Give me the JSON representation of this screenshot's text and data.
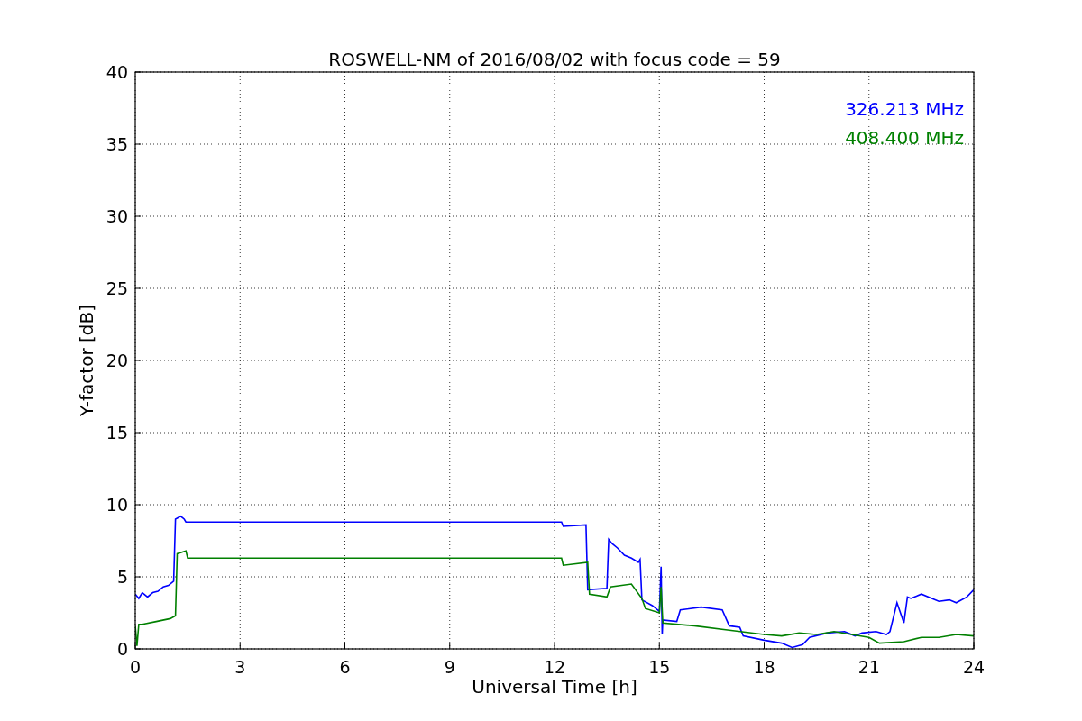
{
  "chart_data": {
    "type": "line",
    "title": "ROSWELL-NM of 2016/08/02 with focus code = 59",
    "xlabel": "Universal Time [h]",
    "ylabel": "Y-factor [dB]",
    "xlim": [
      0,
      24
    ],
    "ylim": [
      0,
      40
    ],
    "xticks": [
      0,
      3,
      6,
      9,
      12,
      15,
      18,
      21,
      24
    ],
    "yticks": [
      0,
      5,
      10,
      15,
      20,
      25,
      30,
      35,
      40
    ],
    "grid": true,
    "series": [
      {
        "name": "326.213 MHz",
        "color": "#0000ff",
        "x": [
          0,
          0.1,
          0.2,
          0.35,
          0.5,
          0.65,
          0.8,
          0.95,
          1.1,
          1.15,
          1.3,
          1.4,
          1.45,
          12.2,
          12.25,
          12.9,
          12.95,
          13.5,
          13.55,
          13.65,
          13.8,
          14.0,
          14.2,
          14.4,
          14.45,
          14.5,
          14.8,
          15.0,
          15.05,
          15.08,
          15.1,
          15.5,
          15.6,
          16.2,
          16.8,
          17.0,
          17.3,
          17.4,
          18.0,
          18.5,
          18.8,
          19.1,
          19.3,
          19.8,
          20.3,
          20.6,
          20.8,
          21.2,
          21.5,
          21.6,
          21.8,
          22.0,
          22.1,
          22.2,
          22.5,
          22.8,
          23.0,
          23.3,
          23.5,
          23.8,
          24
        ],
        "values": [
          3.8,
          3.5,
          3.9,
          3.6,
          3.9,
          4.0,
          4.3,
          4.4,
          4.7,
          9.0,
          9.2,
          9.0,
          8.8,
          8.8,
          8.5,
          8.6,
          4.1,
          4.2,
          7.6,
          7.3,
          7.0,
          6.5,
          6.3,
          6.0,
          6.2,
          3.4,
          3.0,
          2.6,
          5.7,
          1.0,
          2.0,
          1.9,
          2.7,
          2.9,
          2.7,
          1.6,
          1.5,
          0.9,
          0.6,
          0.4,
          0.1,
          0.3,
          0.8,
          1.1,
          1.2,
          0.9,
          1.1,
          1.2,
          1.0,
          1.2,
          3.2,
          1.8,
          3.6,
          3.5,
          3.8,
          3.5,
          3.3,
          3.4,
          3.2,
          3.6,
          4.1
        ]
      },
      {
        "name": "408.400 MHz",
        "color": "#008000",
        "x": [
          0,
          0.05,
          0.1,
          0.2,
          0.6,
          1.0,
          1.15,
          1.2,
          1.45,
          1.5,
          12.2,
          12.25,
          12.95,
          13.0,
          13.5,
          13.6,
          14.2,
          14.5,
          14.6,
          15.0,
          15.05,
          15.1,
          16.0,
          17.0,
          18.0,
          18.5,
          19.0,
          19.5,
          20.0,
          20.5,
          21.0,
          21.3,
          22.0,
          22.5,
          23.0,
          23.5,
          24
        ],
        "values": [
          1.6,
          0.2,
          1.7,
          1.7,
          1.9,
          2.1,
          2.3,
          6.6,
          6.8,
          6.3,
          6.3,
          5.8,
          6.0,
          3.8,
          3.6,
          4.3,
          4.5,
          3.5,
          2.8,
          2.5,
          4.3,
          1.8,
          1.6,
          1.3,
          1.0,
          0.9,
          1.1,
          1.0,
          1.2,
          1.0,
          0.8,
          0.4,
          0.5,
          0.8,
          0.8,
          1.0,
          0.9
        ]
      }
    ]
  }
}
